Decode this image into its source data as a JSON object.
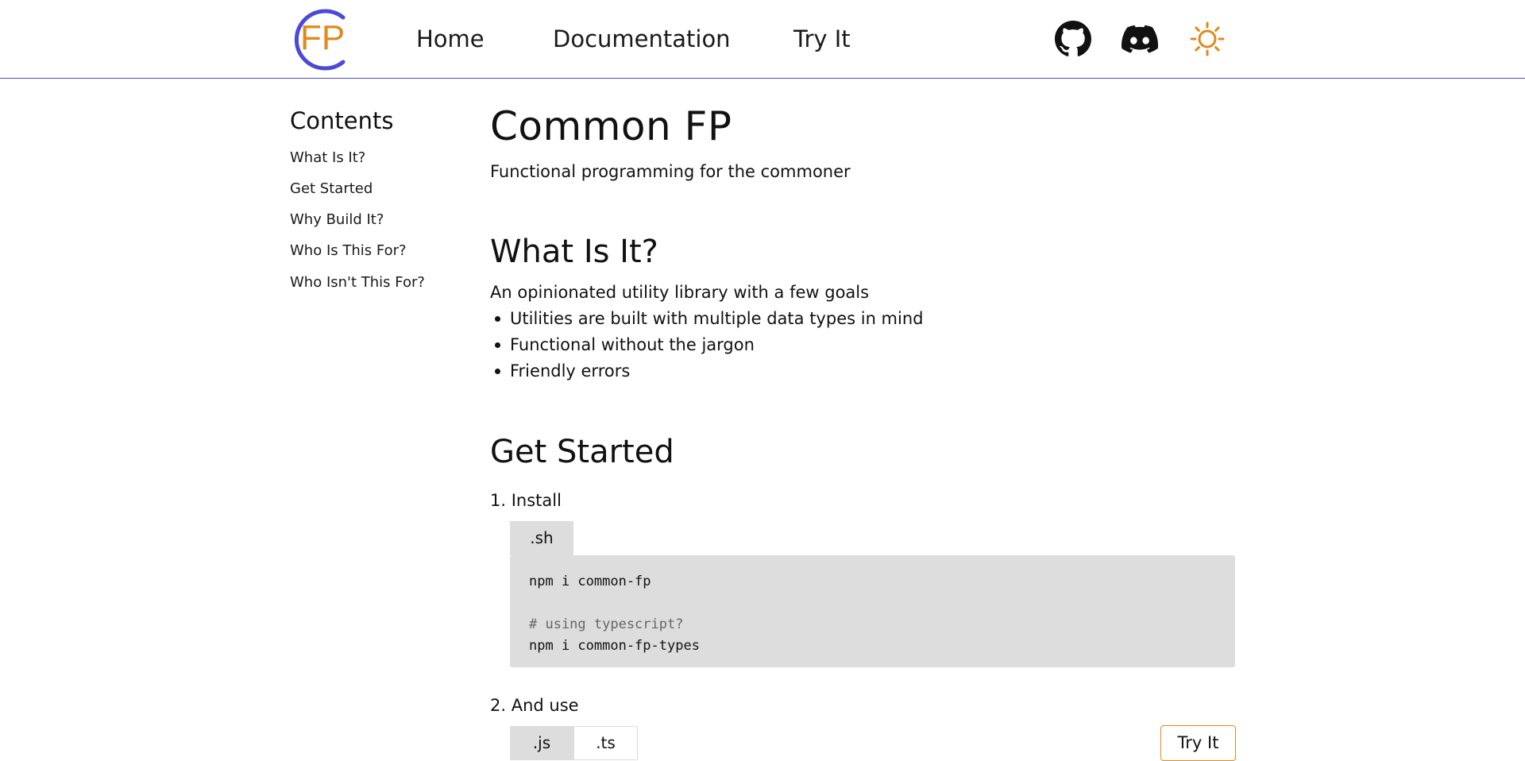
{
  "header": {
    "logo_text": "FP",
    "nav": [
      {
        "label": "Home"
      },
      {
        "label": "Documentation"
      },
      {
        "label": "Try It"
      }
    ],
    "icons": [
      "github-icon",
      "discord-icon",
      "sun-icon"
    ],
    "colors": {
      "accent": "#e08a1e",
      "brand": "#4a4ad6"
    }
  },
  "toc": {
    "title": "Contents",
    "items": [
      {
        "label": "What Is It?"
      },
      {
        "label": "Get Started"
      },
      {
        "label": "Why Build It?"
      },
      {
        "label": "Who Is This For?"
      },
      {
        "label": "Who Isn't This For?"
      }
    ]
  },
  "main": {
    "title": "Common FP",
    "subtitle": "Functional programming for the commoner",
    "what": {
      "heading": "What Is It?",
      "intro": "An opinionated utility library with a few goals",
      "bullets": [
        "Utilities are built with multiple data types in mind",
        "Functional without the jargon",
        "Friendly errors"
      ]
    },
    "get_started": {
      "heading": "Get Started",
      "step1": "1. Install",
      "step1_tab": ".sh",
      "code": {
        "line1": "npm i common-fp",
        "comment": "# using typescript?",
        "line2": "npm i common-fp-types"
      },
      "step2": "2. And use",
      "step2_tabs": [
        ".js",
        ".ts"
      ],
      "try_button": "Try It"
    }
  }
}
